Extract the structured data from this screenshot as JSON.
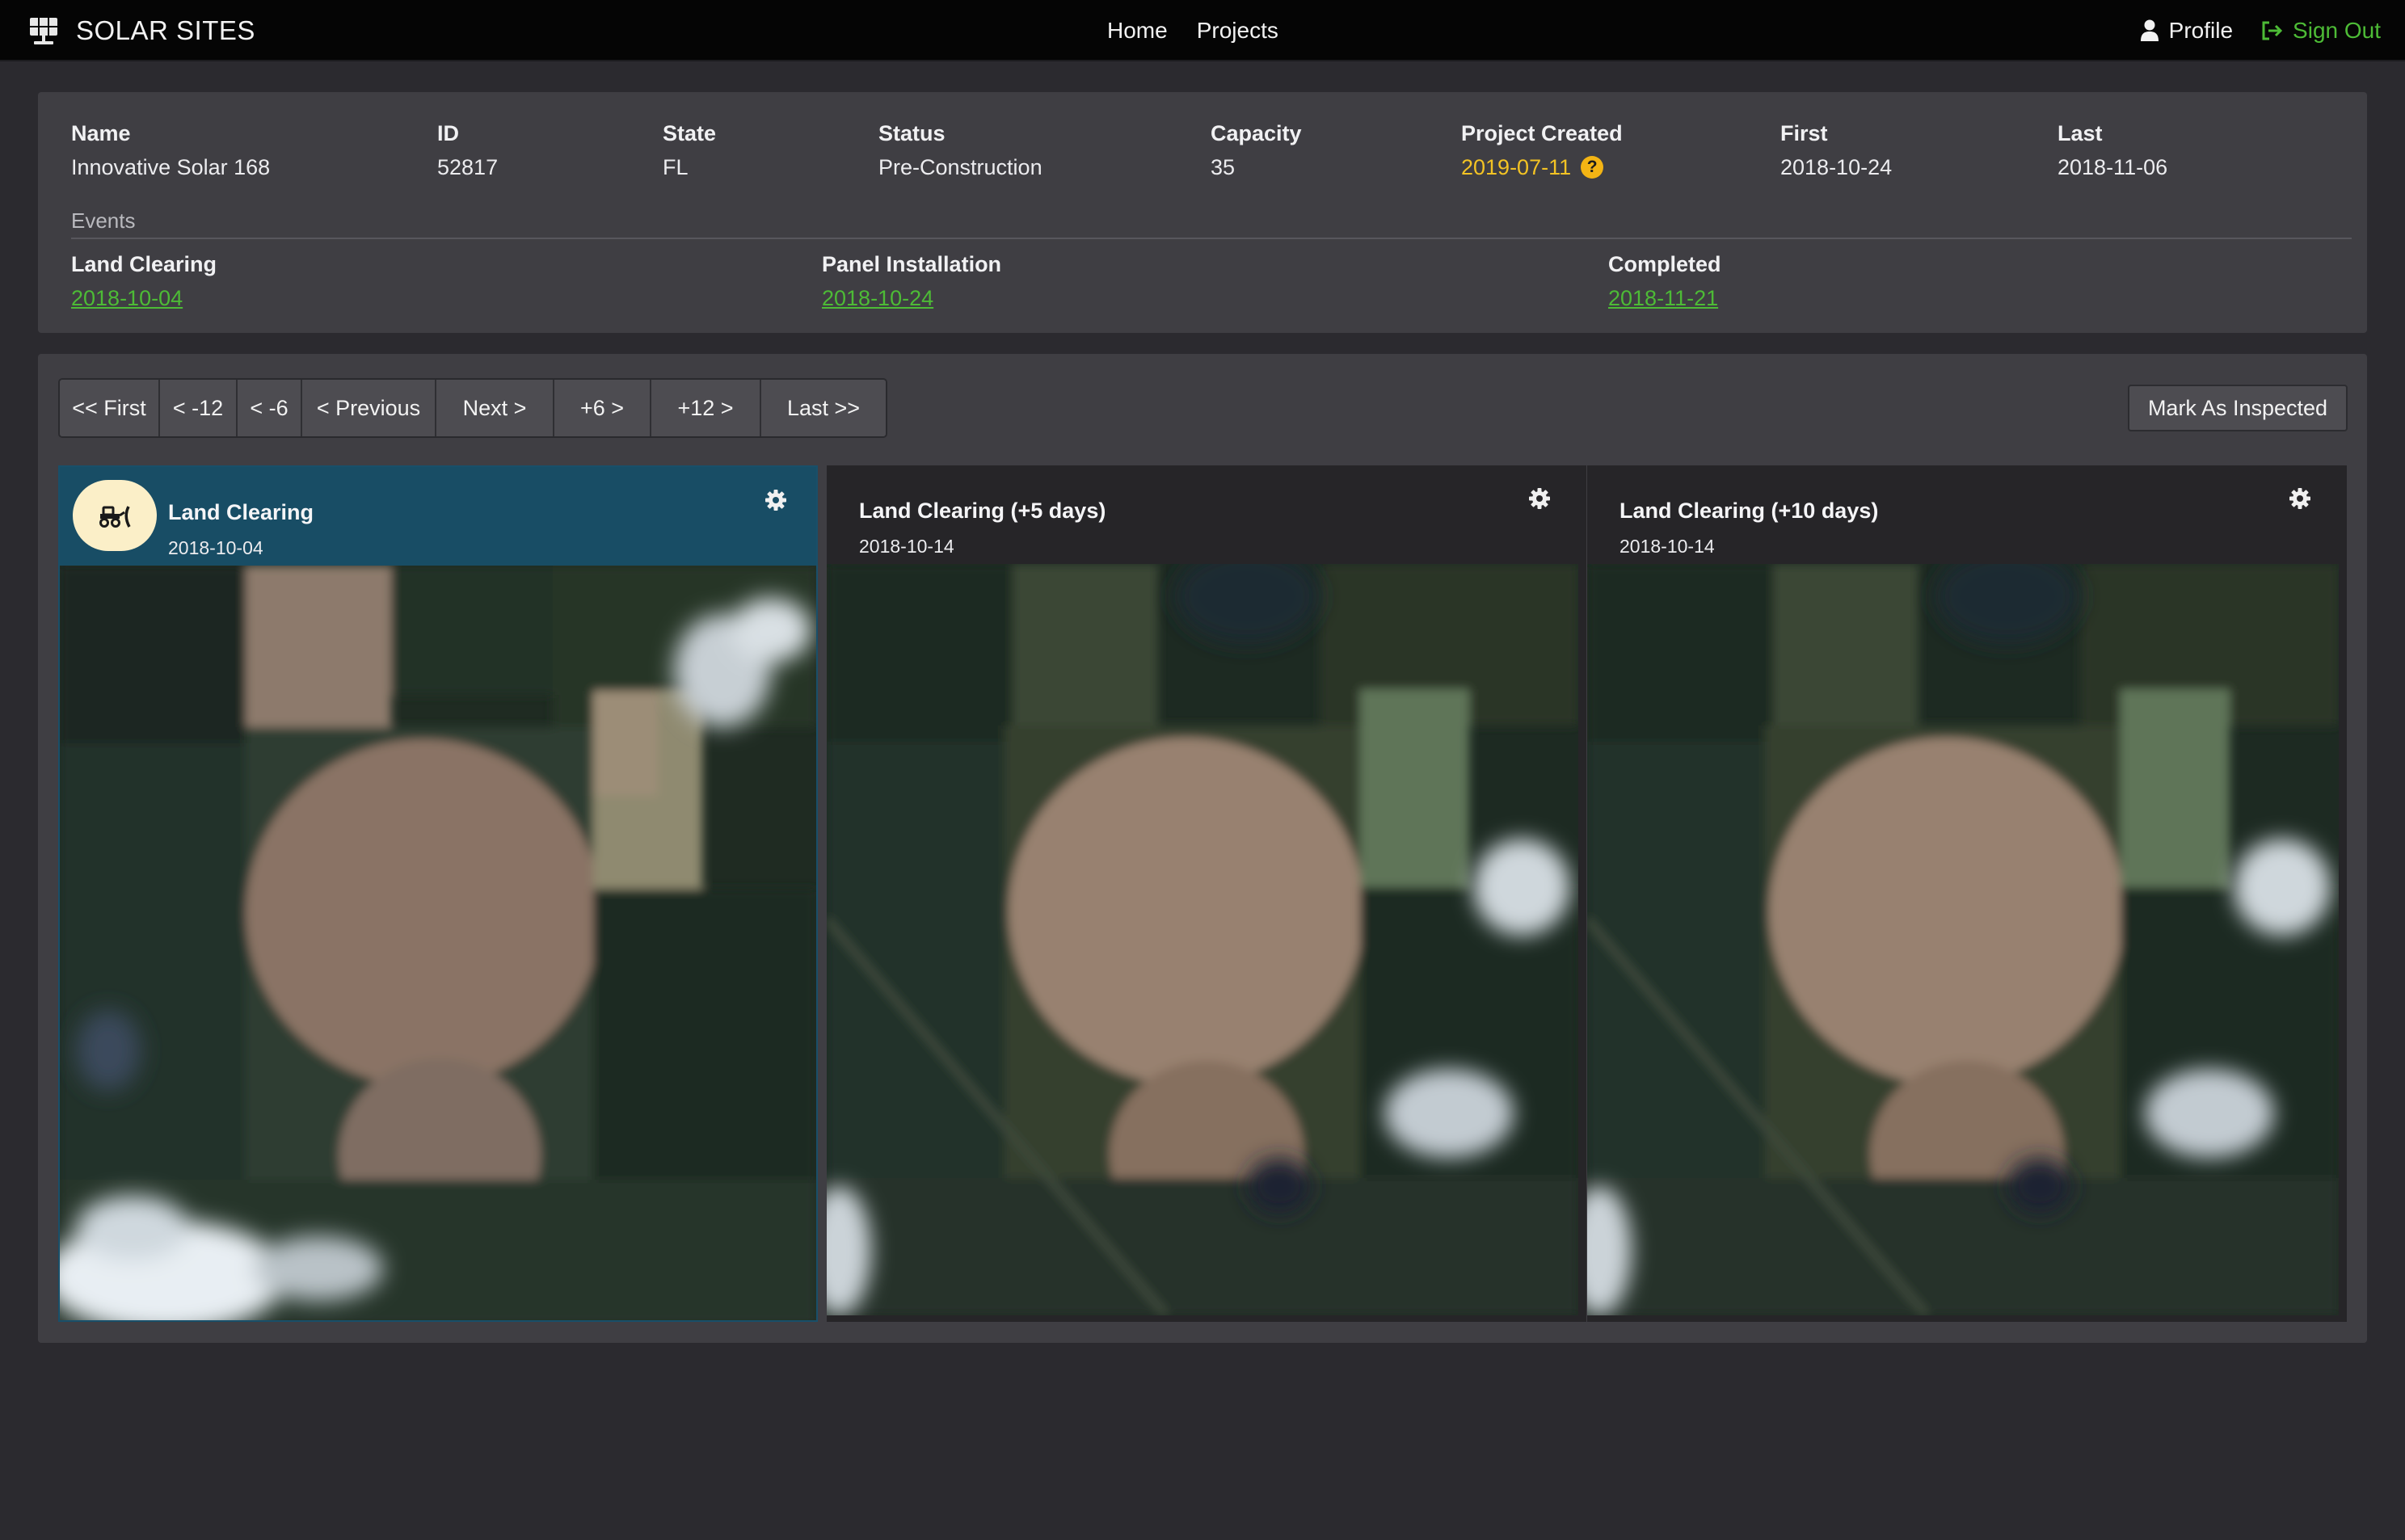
{
  "app": {
    "title": "SOLAR SITES"
  },
  "nav": {
    "home": "Home",
    "projects": "Projects",
    "profile": "Profile",
    "sign_out": "Sign Out"
  },
  "project": {
    "fields": [
      {
        "label": "Name",
        "value": "Innovative Solar 168"
      },
      {
        "label": "ID",
        "value": "52817"
      },
      {
        "label": "State",
        "value": "FL"
      },
      {
        "label": "Status",
        "value": "Pre-Construction"
      },
      {
        "label": "Capacity",
        "value": "35"
      },
      {
        "label": "Project Created",
        "value": "2019-07-11",
        "highlight": true
      },
      {
        "label": "First",
        "value": "2018-10-24"
      },
      {
        "label": "Last",
        "value": "2018-11-06"
      }
    ],
    "help_icon_glyph": "?",
    "events_title": "Events",
    "events": [
      {
        "label": "Land Clearing",
        "date": "2018-10-04"
      },
      {
        "label": "Panel Installation",
        "date": "2018-10-24"
      },
      {
        "label": "Completed",
        "date": "2018-11-21"
      }
    ]
  },
  "pager": {
    "buttons": [
      "<< First",
      "< -12",
      "< -6",
      "< Previous",
      "Next >",
      "+6 >",
      "+12 >",
      "Last >>"
    ],
    "mark_inspected": "Mark As Inspected"
  },
  "cards": [
    {
      "title": "Land Clearing",
      "date": "2018-10-04",
      "active": true,
      "icon": "bulldozer-icon"
    },
    {
      "title": "Land Clearing (+5 days)",
      "date": "2018-10-14",
      "active": false
    },
    {
      "title": "Land Clearing (+10 days)",
      "date": "2018-10-14",
      "active": false
    }
  ],
  "colors": {
    "accent_green": "#4dbb36",
    "active_card": "#184d65",
    "highlight_yellow": "#f3c324"
  }
}
